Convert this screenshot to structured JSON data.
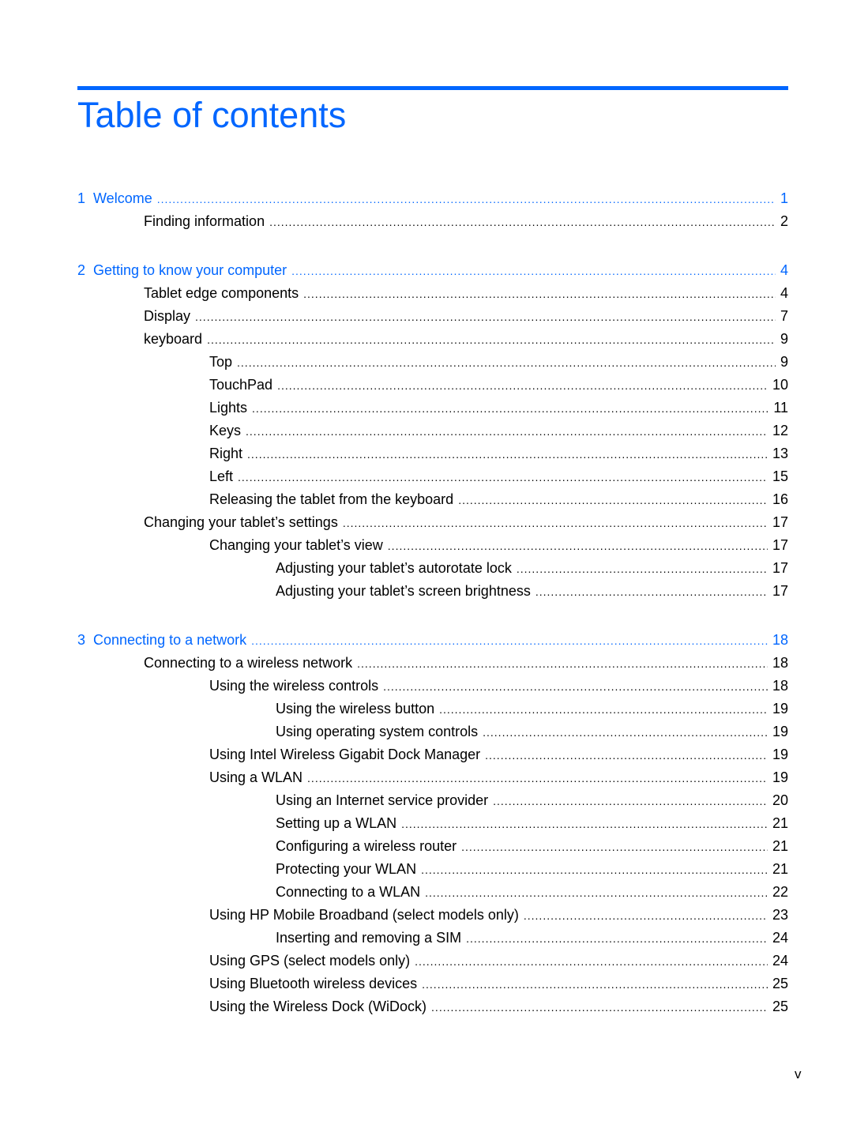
{
  "title": "Table of contents",
  "accent_color": "#0066ff",
  "entries": [
    {
      "level": 0,
      "number": "1",
      "text": "Welcome",
      "page": "1"
    },
    {
      "level": 1,
      "text": "Finding information",
      "page": "2"
    },
    {
      "level": 0,
      "number": "2",
      "text": "Getting to know your computer",
      "page": "4"
    },
    {
      "level": 1,
      "text": "Tablet edge components",
      "page": "4"
    },
    {
      "level": 1,
      "text": "Display",
      "page": "7"
    },
    {
      "level": 1,
      "text": "keyboard",
      "page": "9"
    },
    {
      "level": 2,
      "text": "Top",
      "page": "9"
    },
    {
      "level": 2,
      "text": "TouchPad",
      "page": "10"
    },
    {
      "level": 2,
      "text": "Lights",
      "page": "11"
    },
    {
      "level": 2,
      "text": "Keys",
      "page": "12"
    },
    {
      "level": 2,
      "text": "Right",
      "page": "13"
    },
    {
      "level": 2,
      "text": "Left",
      "page": "15"
    },
    {
      "level": 2,
      "text": "Releasing the tablet from the keyboard",
      "page": "16"
    },
    {
      "level": 1,
      "text": "Changing your tablet’s settings",
      "page": "17"
    },
    {
      "level": 2,
      "text": "Changing your tablet’s view",
      "page": "17"
    },
    {
      "level": 3,
      "text": "Adjusting your tablet’s autorotate lock",
      "page": "17"
    },
    {
      "level": 3,
      "text": "Adjusting your tablet’s screen brightness",
      "page": "17"
    },
    {
      "level": 0,
      "number": "3",
      "text": "Connecting to a network",
      "page": "18"
    },
    {
      "level": 1,
      "text": "Connecting to a wireless network",
      "page": "18"
    },
    {
      "level": 2,
      "text": "Using the wireless controls",
      "page": "18"
    },
    {
      "level": 3,
      "text": "Using the wireless button",
      "page": "19"
    },
    {
      "level": 3,
      "text": "Using operating system controls",
      "page": "19"
    },
    {
      "level": 2,
      "text": "Using Intel Wireless Gigabit Dock Manager",
      "page": "19"
    },
    {
      "level": 2,
      "text": "Using a WLAN",
      "page": "19"
    },
    {
      "level": 3,
      "text": "Using an Internet service provider",
      "page": "20"
    },
    {
      "level": 3,
      "text": "Setting up a WLAN",
      "page": "21"
    },
    {
      "level": 3,
      "text": "Configuring a wireless router",
      "page": "21"
    },
    {
      "level": 3,
      "text": "Protecting your WLAN",
      "page": "21"
    },
    {
      "level": 3,
      "text": "Connecting to a WLAN",
      "page": "22"
    },
    {
      "level": 2,
      "text": "Using HP Mobile Broadband (select models only)",
      "page": "23"
    },
    {
      "level": 3,
      "text": "Inserting and removing a SIM",
      "page": "24"
    },
    {
      "level": 2,
      "text": "Using GPS (select models only)",
      "page": "24"
    },
    {
      "level": 2,
      "text": "Using Bluetooth wireless devices",
      "page": "25"
    },
    {
      "level": 2,
      "text": "Using the Wireless Dock (WiDock)",
      "page": "25"
    }
  ],
  "folio": "v"
}
